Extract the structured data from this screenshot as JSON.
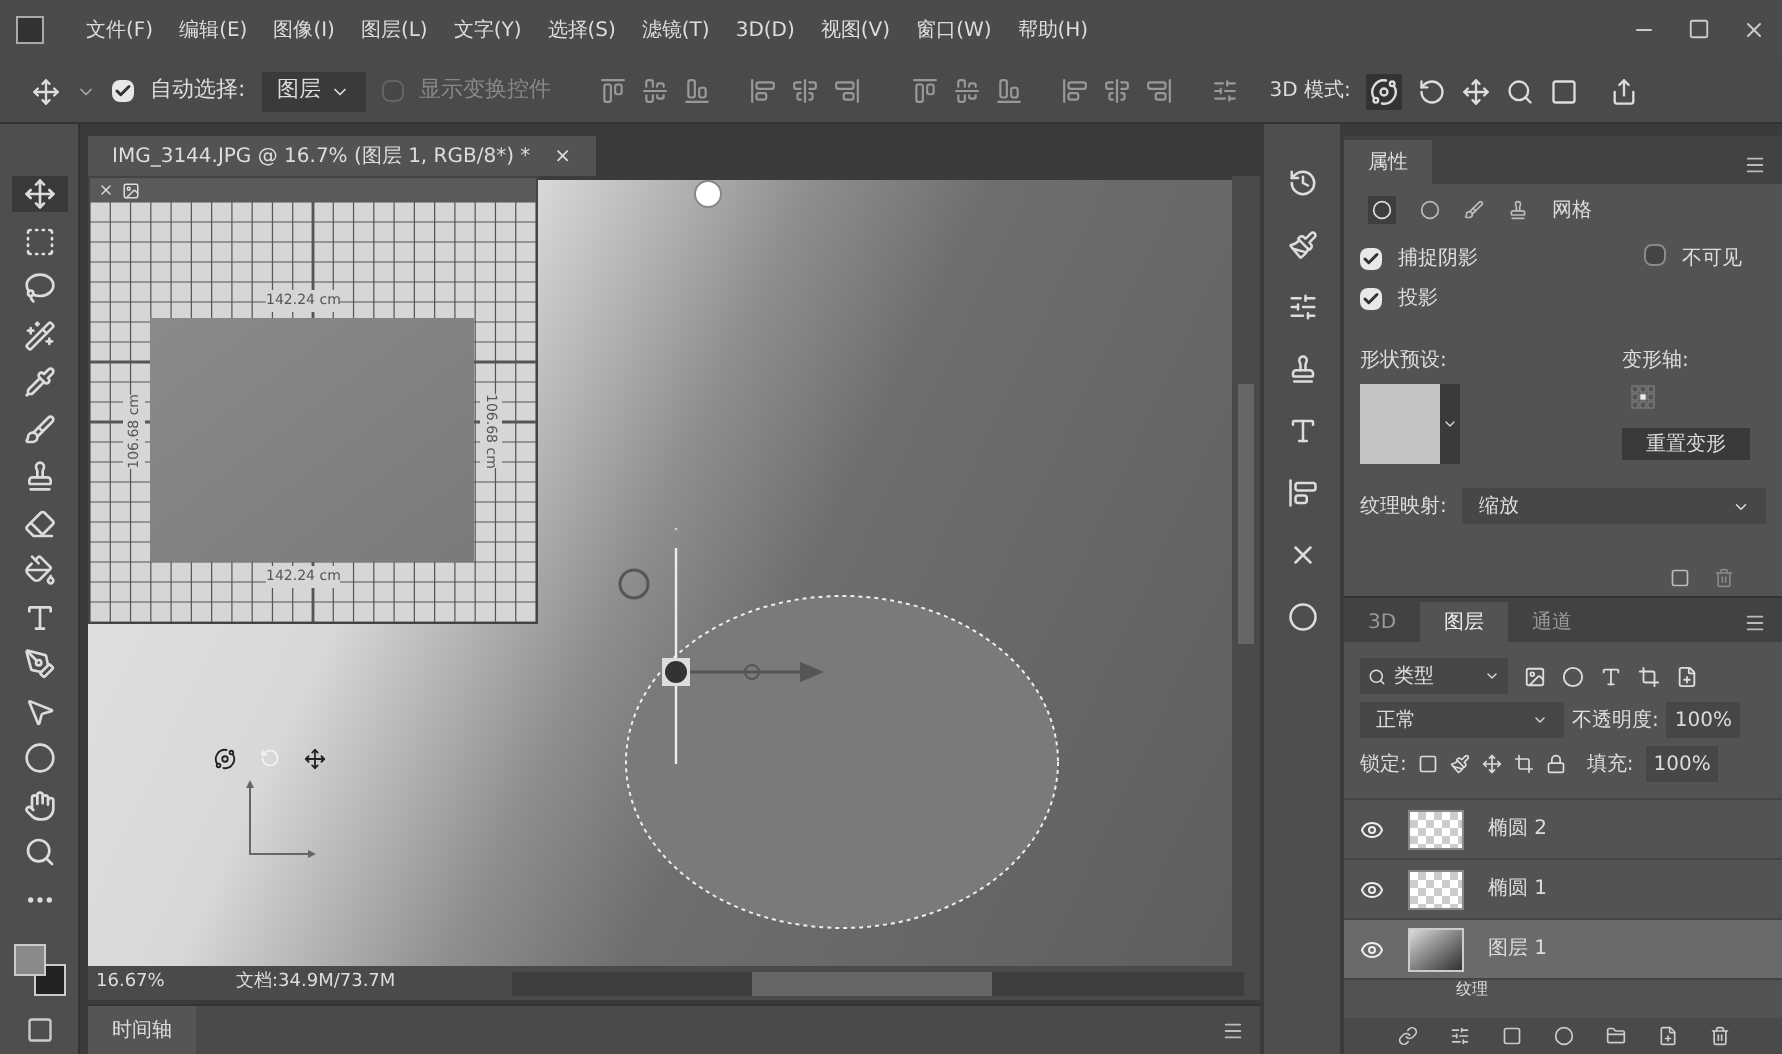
{
  "menu": [
    "文件(F)",
    "编辑(E)",
    "图像(I)",
    "图层(L)",
    "文字(Y)",
    "选择(S)",
    "滤镜(T)",
    "3D(D)",
    "视图(V)",
    "窗口(W)",
    "帮助(H)"
  ],
  "options_bar": {
    "auto_select": {
      "label": "自动选择:",
      "checked": true
    },
    "target": "图层",
    "show_transform": {
      "label": "显示变换控件",
      "checked": false,
      "disabled": true
    },
    "mode_label": "3D 模式:"
  },
  "document_tab": {
    "title": "IMG_3144.JPG @ 16.7% (图层 1, RGB/8*) *",
    "close": "×"
  },
  "secondary_view": {
    "top_label": "142.24 cm",
    "bottom_label": "142.24 cm",
    "left_label": "106.68 cm",
    "right_label": "106.68 cm"
  },
  "status_bar": {
    "zoom": "16.67%",
    "document": "文档:34.9M/73.7M"
  },
  "timeline": {
    "title": "时间轴"
  },
  "properties": {
    "tab": "属性",
    "mesh_label": "网格",
    "options": [
      {
        "label": "捕捉阴影",
        "checked": true
      },
      {
        "label": "投影",
        "checked": true
      }
    ],
    "invisible": {
      "label": "不可见",
      "checked": false
    },
    "shape_preset_label": "形状预设:",
    "deform_axis_label": "变形轴:",
    "reset_button": "重置变形",
    "texture_mapping_label": "纹理映射:",
    "texture_mapping_value": "缩放"
  },
  "layers_panel": {
    "tabs": [
      {
        "label": "3D",
        "selected": false
      },
      {
        "label": "图层",
        "selected": true
      },
      {
        "label": "通道",
        "selected": false
      }
    ],
    "filter": "类型",
    "blend": "正常",
    "opacity_label": "不透明度:",
    "opacity": "100%",
    "lock_label": "锁定:",
    "fill_label": "填充:",
    "fill": "100%",
    "layers": [
      {
        "name": "椭圆 2",
        "kind": "shape",
        "selected": false,
        "visible": true
      },
      {
        "name": "椭圆 1",
        "kind": "shape",
        "selected": false,
        "visible": true
      },
      {
        "name": "图层 1",
        "kind": "object",
        "selected": true,
        "visible": true
      }
    ],
    "sub_item": "纹理"
  }
}
